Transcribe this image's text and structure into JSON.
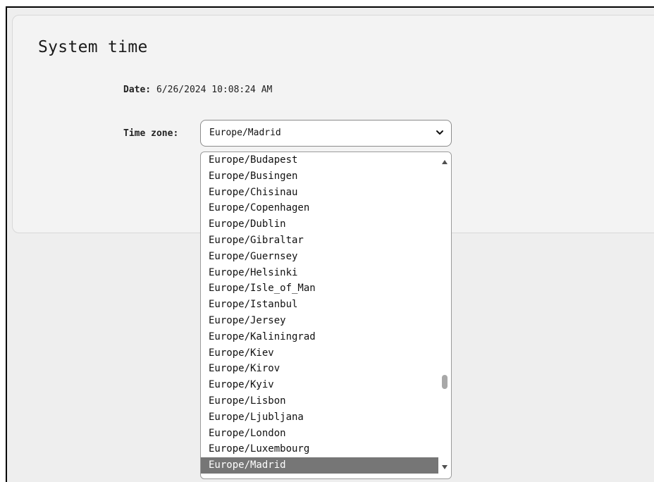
{
  "page": {
    "title": "System time"
  },
  "date": {
    "label": "Date:",
    "value": "6/26/2024 10:08:24 AM"
  },
  "timezone": {
    "label": "Time zone:",
    "selected": "Europe/Madrid",
    "options": [
      "Europe/Budapest",
      "Europe/Busingen",
      "Europe/Chisinau",
      "Europe/Copenhagen",
      "Europe/Dublin",
      "Europe/Gibraltar",
      "Europe/Guernsey",
      "Europe/Helsinki",
      "Europe/Isle_of_Man",
      "Europe/Istanbul",
      "Europe/Jersey",
      "Europe/Kaliningrad",
      "Europe/Kiev",
      "Europe/Kirov",
      "Europe/Kyiv",
      "Europe/Lisbon",
      "Europe/Ljubljana",
      "Europe/London",
      "Europe/Luxembourg",
      "Europe/Madrid"
    ]
  },
  "icons": {
    "select_arrow": "chevron-down-icon",
    "scroll_up": "scroll-up-arrow-icon",
    "scroll_down": "scroll-down-arrow-icon"
  },
  "colors": {
    "selected_option_bg": "#767676",
    "selected_option_text": "#ffffff",
    "panel_bg": "#f3f3f3",
    "page_bg": "#eeeeee"
  }
}
